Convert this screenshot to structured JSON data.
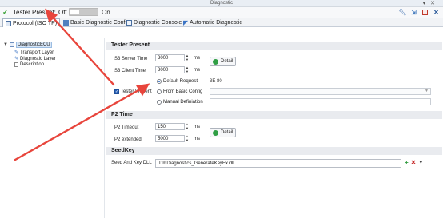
{
  "window": {
    "title": "Diagnostic"
  },
  "toolbar": {
    "tester_present_label": "Tester Present:",
    "off_label": "Off",
    "on_label": "On",
    "toggle_state": "off",
    "icons": [
      "wrench-icon",
      "undock-icon",
      "save-icon",
      "close-icon"
    ]
  },
  "tabs": [
    {
      "label": "Protocol (ISO TP)",
      "icon": "protocol-icon",
      "active": true
    },
    {
      "label": "Basic Diagnostic Config",
      "icon": "config-icon",
      "active": false
    },
    {
      "label": "Diagnostic Console",
      "icon": "console-icon",
      "active": false
    },
    {
      "label": "Automatic Diagnostic",
      "icon": "send-icon",
      "active": false
    }
  ],
  "tree": {
    "root": "DiagnosticECU",
    "children": [
      "Transport Layer",
      "Diagnostic Layer",
      "Description"
    ]
  },
  "tester_present": {
    "header": "Tester Present",
    "s3_server_label": "S3 Server Time",
    "s3_server_value": "3000",
    "s3_client_label": "S3 Client Time",
    "s3_client_value": "3000",
    "unit": "ms",
    "detail_label": "Detail",
    "checkbox_label": "Tester Present",
    "checkbox_checked": true,
    "radio_default": "Default Request",
    "radio_from_basic": "From Basic Config",
    "radio_manual": "Manual Definiation",
    "selected_radio": "Default Request",
    "default_hex": "3E 80"
  },
  "p2_time": {
    "header": "P2 Time",
    "p2_timeout_label": "P2 Timeout",
    "p2_timeout_value": "150",
    "p2_extended_label": "P2 extended",
    "p2_extended_value": "5000",
    "unit": "ms",
    "detail_label": "Detail"
  },
  "seed_key": {
    "header": "SeedKey",
    "dll_label": "Seed And Key DLL",
    "dll_value": "TfmDiagnostics_GenerateKeyEx.dll"
  },
  "colors": {
    "accent": "#2a62b8",
    "annotation_arrow": "#e8453c",
    "section_bg": "#e9ebef"
  }
}
